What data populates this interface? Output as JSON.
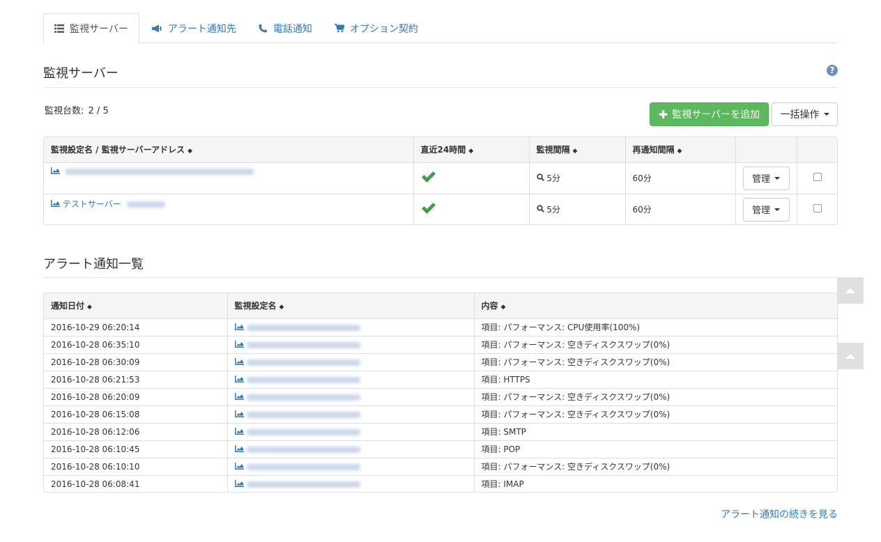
{
  "tabs": [
    {
      "label": "監視サーバー",
      "icon": "list-icon",
      "active": true
    },
    {
      "label": "アラート通知先",
      "icon": "megaphone-icon",
      "active": false
    },
    {
      "label": "電話通知",
      "icon": "phone-icon",
      "active": false
    },
    {
      "label": "オプション契約",
      "icon": "cart-icon",
      "active": false
    }
  ],
  "servers_section": {
    "title": "監視サーバー",
    "help": "?",
    "count_label": "監視台数:",
    "count_value": "2 / 5",
    "add_button": "監視サーバーを追加",
    "bulk_button": "一括操作",
    "columns": [
      "監視設定名 / 監視サーバーアドレス",
      "直近24時間",
      "監視間隔",
      "再通知間隔",
      "",
      ""
    ],
    "rows": [
      {
        "name": "",
        "interval": "5分",
        "renotify": "60分",
        "manage": "管理"
      },
      {
        "name": "テストサーバー",
        "interval": "5分",
        "renotify": "60分",
        "manage": "管理"
      }
    ]
  },
  "alerts_section": {
    "title": "アラート通知一覧",
    "columns": [
      "通知日付",
      "監視設定名",
      "内容"
    ],
    "rows": [
      {
        "date": "2016-10-29 06:20:14",
        "content": "項目: パフォーマンス: CPU使用率(100%)"
      },
      {
        "date": "2016-10-28 06:35:10",
        "content": "項目: パフォーマンス: 空きディスクスワップ(0%)"
      },
      {
        "date": "2016-10-28 06:30:09",
        "content": "項目: パフォーマンス: 空きディスクスワップ(0%)"
      },
      {
        "date": "2016-10-28 06:21:53",
        "content": "項目: HTTPS"
      },
      {
        "date": "2016-10-28 06:20:09",
        "content": "項目: パフォーマンス: 空きディスクスワップ(0%)"
      },
      {
        "date": "2016-10-28 06:15:08",
        "content": "項目: パフォーマンス: 空きディスクスワップ(0%)"
      },
      {
        "date": "2016-10-28 06:12:06",
        "content": "項目: SMTP"
      },
      {
        "date": "2016-10-28 06:10:45",
        "content": "項目: POP"
      },
      {
        "date": "2016-10-28 06:10:10",
        "content": "項目: パフォーマンス: 空きディスクスワップ(0%)"
      },
      {
        "date": "2016-10-28 06:08:41",
        "content": "項目: IMAP"
      }
    ],
    "more_link": "アラート通知の続きを見る"
  },
  "colors": {
    "link": "#337ab7",
    "success": "#5cb85c",
    "check": "#449d44"
  }
}
